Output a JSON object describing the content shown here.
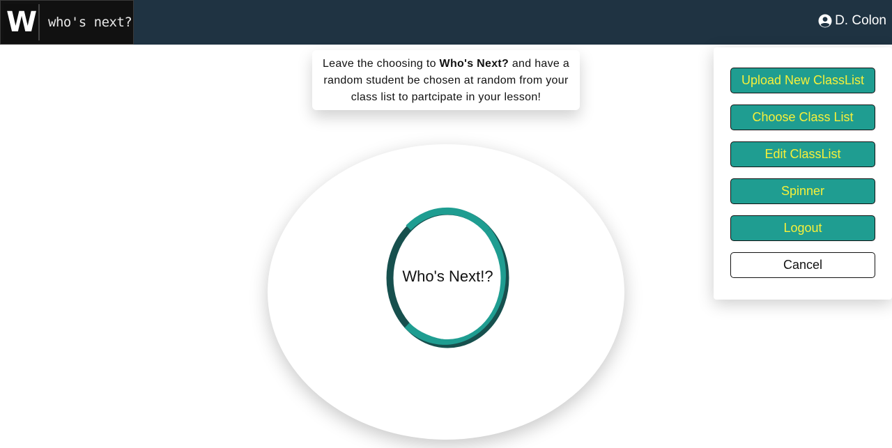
{
  "app": {
    "logo_letter": "W",
    "logo_text": "who's next?"
  },
  "header": {
    "user_name": "D. Colon",
    "user_icon": "user-circle-icon"
  },
  "intro": {
    "prefix": "Leave the choosing to ",
    "brand": "Who's Next?",
    "suffix": " and have a random student be chosen at random from your class list to partcipate in your lesson!"
  },
  "spinner": {
    "label": "Who's Next!?",
    "ring_colors": {
      "light": "#1f9d91",
      "dark": "#17504e"
    }
  },
  "menu": {
    "items": [
      {
        "label": "Upload New ClassList"
      },
      {
        "label": "Choose Class List"
      },
      {
        "label": "Edit ClassList"
      },
      {
        "label": "Spinner"
      },
      {
        "label": "Logout"
      },
      {
        "label": "Cancel"
      }
    ]
  },
  "colors": {
    "navbar": "#1f3342",
    "button_bg": "#1f9d91",
    "button_text": "#f7f03a"
  }
}
